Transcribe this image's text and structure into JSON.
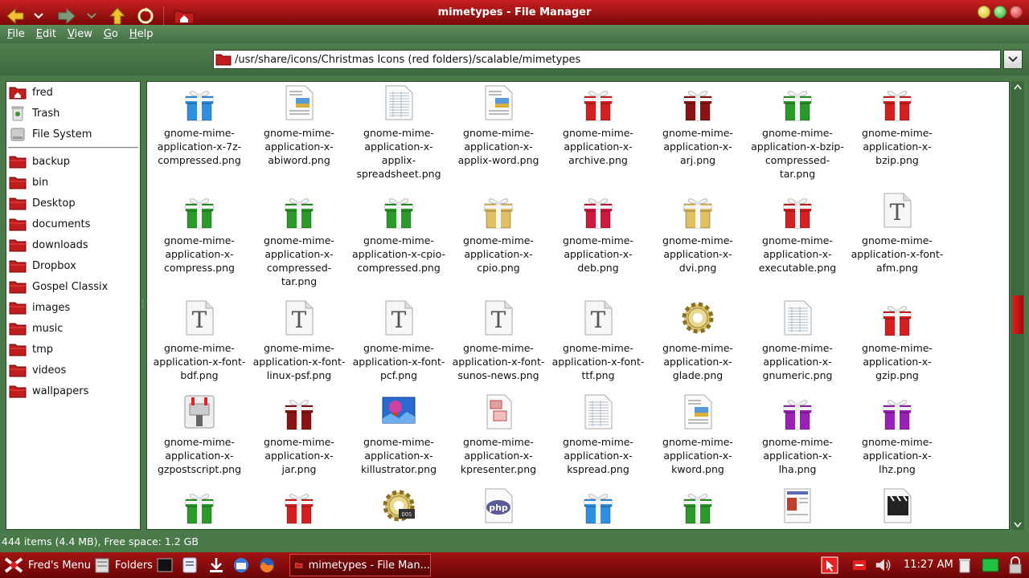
{
  "window": {
    "title": "mimetypes - File Manager"
  },
  "menu": [
    "File",
    "Edit",
    "View",
    "Go",
    "Help"
  ],
  "location": {
    "path": "/usr/share/icons/Christmas Icons (red folders)/scalable/mimetypes"
  },
  "sidebar": {
    "places": [
      {
        "label": "fred",
        "icon": "home-folder"
      },
      {
        "label": "Trash",
        "icon": "trash"
      },
      {
        "label": "File System",
        "icon": "drive"
      }
    ],
    "bookmarks": [
      "backup",
      "bin",
      "Desktop",
      "documents",
      "downloads",
      "Dropbox",
      "Gospel Classix",
      "images",
      "music",
      "tmp",
      "videos",
      "wallpapers"
    ]
  },
  "files": [
    {
      "name": "gnome-mime-application-x-7z-compressed.png",
      "lines": [
        "gnome-mime-",
        "application-x-7z-",
        "compressed.png"
      ],
      "icon": "gift",
      "color": "#2f8fe0"
    },
    {
      "name": "gnome-mime-application-x-abiword.png",
      "lines": [
        "gnome-mime-",
        "application-x-",
        "abiword.png"
      ],
      "icon": "doc-image"
    },
    {
      "name": "gnome-mime-application-x-applix-spreadsheet.png",
      "lines": [
        "gnome-mime-",
        "application-x-",
        "applix-",
        "spreadsheet.png"
      ],
      "icon": "sheet"
    },
    {
      "name": "gnome-mime-application-x-applix-word.png",
      "lines": [
        "gnome-mime-",
        "application-x-",
        "applix-word.png"
      ],
      "icon": "doc-image"
    },
    {
      "name": "gnome-mime-application-x-archive.png",
      "lines": [
        "gnome-mime-",
        "application-x-",
        "archive.png"
      ],
      "icon": "gift",
      "color": "#d42020"
    },
    {
      "name": "gnome-mime-application-x-arj.png",
      "lines": [
        "gnome-mime-",
        "application-x-",
        "arj.png"
      ],
      "icon": "gift",
      "color": "#8a1414"
    },
    {
      "name": "gnome-mime-application-x-bzip-compressed-tar.png",
      "lines": [
        "gnome-mime-",
        "application-x-bzip-",
        "compressed-",
        "tar.png"
      ],
      "icon": "gift",
      "color": "#2a9a2a"
    },
    {
      "name": "gnome-mime-application-x-bzip.png",
      "lines": [
        "gnome-mime-",
        "application-x-",
        "bzip.png"
      ],
      "icon": "gift",
      "color": "#d42020"
    },
    {
      "name": "gnome-mime-application-x-compress.png",
      "lines": [
        "gnome-mime-",
        "application-x-",
        "compress.png"
      ],
      "icon": "gift",
      "color": "#2a9a2a"
    },
    {
      "name": "gnome-mime-application-x-compressed-tar.png",
      "lines": [
        "gnome-mime-",
        "application-x-",
        "compressed-",
        "tar.png"
      ],
      "icon": "gift",
      "color": "#2a9a2a"
    },
    {
      "name": "gnome-mime-application-x-cpio-compressed.png",
      "lines": [
        "gnome-mime-",
        "application-x-cpio-",
        "compressed.png"
      ],
      "icon": "gift",
      "color": "#2a9a2a"
    },
    {
      "name": "gnome-mime-application-x-cpio.png",
      "lines": [
        "gnome-mime-",
        "application-x-",
        "cpio.png"
      ],
      "icon": "gift",
      "color": "#e0c060"
    },
    {
      "name": "gnome-mime-application-x-deb.png",
      "lines": [
        "gnome-mime-",
        "application-x-",
        "deb.png"
      ],
      "icon": "gift",
      "color": "#d01840"
    },
    {
      "name": "gnome-mime-application-x-dvi.png",
      "lines": [
        "gnome-mime-",
        "application-x-",
        "dvi.png"
      ],
      "icon": "gift",
      "color": "#e0c060"
    },
    {
      "name": "gnome-mime-application-x-executable.png",
      "lines": [
        "gnome-mime-",
        "application-x-",
        "executable.png"
      ],
      "icon": "gift",
      "color": "#d42020"
    },
    {
      "name": "gnome-mime-application-x-font-afm.png",
      "lines": [
        "gnome-mime-",
        "application-x-font-",
        "afm.png"
      ],
      "icon": "font"
    },
    {
      "name": "gnome-mime-application-x-font-bdf.png",
      "lines": [
        "gnome-mime-",
        "application-x-font-",
        "bdf.png"
      ],
      "icon": "font"
    },
    {
      "name": "gnome-mime-application-x-font-linux-psf.png",
      "lines": [
        "gnome-mime-",
        "application-x-font-",
        "linux-psf.png"
      ],
      "icon": "font"
    },
    {
      "name": "gnome-mime-application-x-font-pcf.png",
      "lines": [
        "gnome-mime-",
        "application-x-font-",
        "pcf.png"
      ],
      "icon": "font"
    },
    {
      "name": "gnome-mime-application-x-font-sunos-news.png",
      "lines": [
        "gnome-mime-",
        "application-x-font-",
        "sunos-news.png"
      ],
      "icon": "font"
    },
    {
      "name": "gnome-mime-application-x-font-ttf.png",
      "lines": [
        "gnome-mime-",
        "application-x-font-",
        "ttf.png"
      ],
      "icon": "font"
    },
    {
      "name": "gnome-mime-application-x-glade.png",
      "lines": [
        "gnome-mime-",
        "application-x-",
        "glade.png"
      ],
      "icon": "gear"
    },
    {
      "name": "gnome-mime-application-x-gnumeric.png",
      "lines": [
        "gnome-mime-",
        "application-x-",
        "gnumeric.png"
      ],
      "icon": "sheet"
    },
    {
      "name": "gnome-mime-application-x-gzip.png",
      "lines": [
        "gnome-mime-",
        "application-x-",
        "gzip.png"
      ],
      "icon": "gift",
      "color": "#d42020"
    },
    {
      "name": "gnome-mime-application-x-gzpostscript.png",
      "lines": [
        "gnome-mime-",
        "application-x-",
        "gzpostscript.png"
      ],
      "icon": "vise"
    },
    {
      "name": "gnome-mime-application-x-jar.png",
      "lines": [
        "gnome-mime-",
        "application-x-",
        "jar.png"
      ],
      "icon": "gift",
      "color": "#8a1414"
    },
    {
      "name": "gnome-mime-application-x-killustrator.png",
      "lines": [
        "gnome-mime-",
        "application-x-",
        "killustrator.png"
      ],
      "icon": "balloon"
    },
    {
      "name": "gnome-mime-application-x-kpresenter.png",
      "lines": [
        "gnome-mime-",
        "application-x-",
        "kpresenter.png"
      ],
      "icon": "slides"
    },
    {
      "name": "gnome-mime-application-x-kspread.png",
      "lines": [
        "gnome-mime-",
        "application-x-",
        "kspread.png"
      ],
      "icon": "sheet"
    },
    {
      "name": "gnome-mime-application-x-kword.png",
      "lines": [
        "gnome-mime-",
        "application-x-",
        "kword.png"
      ],
      "icon": "doc-image"
    },
    {
      "name": "gnome-mime-application-x-lha.png",
      "lines": [
        "gnome-mime-",
        "application-x-",
        "lha.png"
      ],
      "icon": "gift",
      "color": "#9a20b8"
    },
    {
      "name": "gnome-mime-application-x-lhz.png",
      "lines": [
        "gnome-mime-",
        "application-x-",
        "lhz.png"
      ],
      "icon": "gift",
      "color": "#9a20b8"
    },
    {
      "name": "",
      "lines": [],
      "icon": "gift",
      "color": "#2a9a2a"
    },
    {
      "name": "",
      "lines": [],
      "icon": "gift",
      "color": "#d42020"
    },
    {
      "name": "",
      "lines": [],
      "icon": "gear-dos"
    },
    {
      "name": "",
      "lines": [],
      "icon": "php"
    },
    {
      "name": "",
      "lines": [],
      "icon": "gift",
      "color": "#2f8fe0"
    },
    {
      "name": "",
      "lines": [],
      "icon": "gift",
      "color": "#2a9a2a"
    },
    {
      "name": "",
      "lines": [],
      "icon": "newspaper"
    },
    {
      "name": "",
      "lines": [],
      "icon": "clapper"
    }
  ],
  "status": {
    "text": "444 items (4.4 MB), Free space: 1.2 GB"
  },
  "taskbar": {
    "menu_label": "Fred's Menu",
    "folders_label": "Folders",
    "task_label": "mimetypes - File Man...",
    "clock": "11:27 AM"
  },
  "colors": {
    "titlebar": "#b01414",
    "chrome": "#4a7a4a",
    "folder": "#c41c1c",
    "taskbar": "#8a0c0c"
  }
}
